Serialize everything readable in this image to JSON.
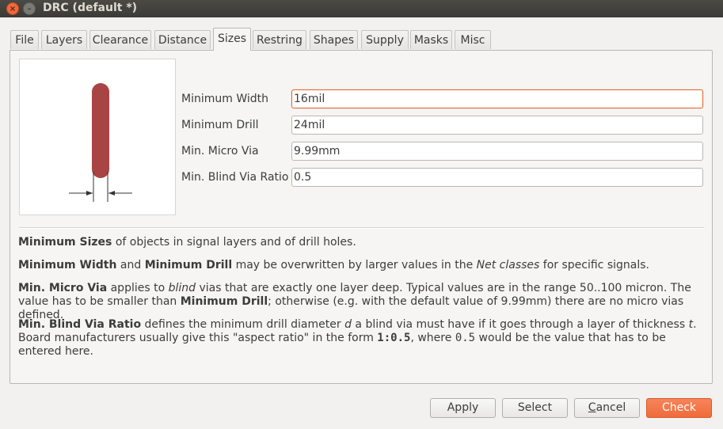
{
  "window": {
    "title": "DRC (default *)",
    "close_glyph": "×",
    "minimize_glyph": "–"
  },
  "tabs": [
    {
      "label": "File"
    },
    {
      "label": "Layers"
    },
    {
      "label": "Clearance"
    },
    {
      "label": "Distance"
    },
    {
      "label": "Sizes",
      "active": true
    },
    {
      "label": "Restring"
    },
    {
      "label": "Shapes"
    },
    {
      "label": "Supply"
    },
    {
      "label": "Masks"
    },
    {
      "label": "Misc"
    }
  ],
  "fields": {
    "min_width": {
      "label": "Minimum Width",
      "value": "16mil"
    },
    "min_drill": {
      "label": "Minimum Drill",
      "value": "24mil"
    },
    "min_micro_via": {
      "label": "Min. Micro Via",
      "value": "9.99mm"
    },
    "min_blind_via_ratio": {
      "label": "Min. Blind Via Ratio",
      "value": "0.5"
    }
  },
  "help": {
    "p1": {
      "b1": "Minimum Sizes",
      "t1": " of objects in signal layers and of drill holes."
    },
    "p2": {
      "b1": "Minimum Width",
      "t1": " and ",
      "b2": "Minimum Drill",
      "t2": " may be overwritten by larger values in the ",
      "i1": "Net classes",
      "t3": " for specific signals."
    },
    "p3": {
      "b1": "Min. Micro Via",
      "t1": " applies to ",
      "i1": "blind",
      "t2": " vias that are exactly one layer deep. Typical values are in the range 50..100 micron. The value has to be smaller than ",
      "b2": "Minimum Drill",
      "t3": "; otherwise (e.g. with the default value of 9.99mm) there are no micro vias defined."
    },
    "p4": {
      "b1": "Min. Blind Via Ratio",
      "t1": " defines the minimum drill diameter ",
      "i1": "d",
      "t2": " a blind via must have if it goes through a layer of thickness ",
      "i2": "t",
      "t3": ". Board manufacturers usually give this \"aspect ratio\" in the form ",
      "m1": "1:0.5",
      "t4": ", where ",
      "m2": "0.5",
      "t5": " would be the value that has to be entered here."
    }
  },
  "buttons": {
    "apply": "Apply",
    "select": "Select",
    "cancel_first": "C",
    "cancel_rest": "ancel",
    "check": "Check"
  },
  "colors": {
    "trace": "#a94444",
    "accent": "#ef6b3b"
  },
  "icons": {
    "preview": "min-width-trace-diagram"
  }
}
